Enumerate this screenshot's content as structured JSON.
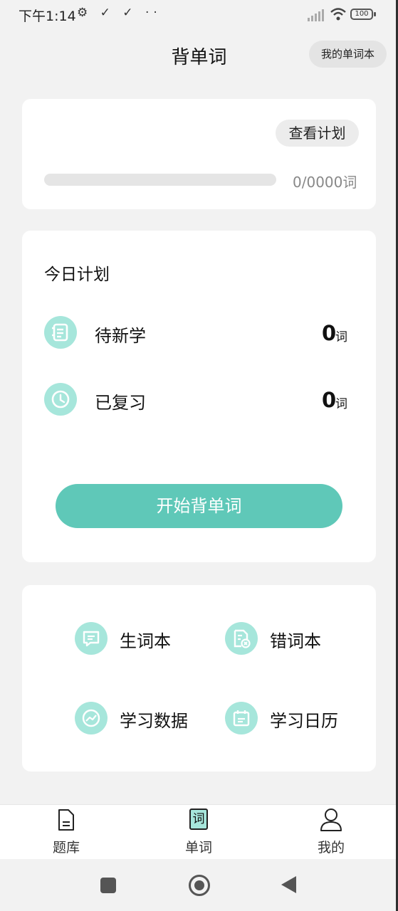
{
  "status_bar": {
    "time": "下午1:14",
    "left_icons": "⚙ ✓ ✓ ··",
    "battery": "100"
  },
  "header": {
    "title": "背单词",
    "wordbook_button": "我的单词本"
  },
  "progress_card": {
    "view_plan_button": "查看计划",
    "progress_fraction": 0,
    "progress_text": "0/0000词"
  },
  "plan_card": {
    "title": "今日计划",
    "rows": [
      {
        "label": "待新学",
        "count": "0",
        "unit": "词",
        "icon": "notebook-icon"
      },
      {
        "label": "已复习",
        "count": "0",
        "unit": "词",
        "icon": "clock-icon"
      }
    ],
    "start_button": "开始背单词"
  },
  "tools_card": {
    "items": [
      {
        "label": "生词本",
        "icon": "message-icon"
      },
      {
        "label": "错词本",
        "icon": "error-doc-icon"
      },
      {
        "label": "学习数据",
        "icon": "chart-icon"
      },
      {
        "label": "学习日历",
        "icon": "calendar-icon"
      }
    ]
  },
  "tabbar": {
    "tabs": [
      {
        "label": "题库",
        "icon": "document-icon"
      },
      {
        "label": "单词",
        "icon": "word-icon"
      },
      {
        "label": "我的",
        "icon": "user-icon"
      }
    ]
  },
  "colors": {
    "accent": "#5fc8b8",
    "icon_bg": "#a6e6db",
    "background": "#f2f2f2"
  }
}
